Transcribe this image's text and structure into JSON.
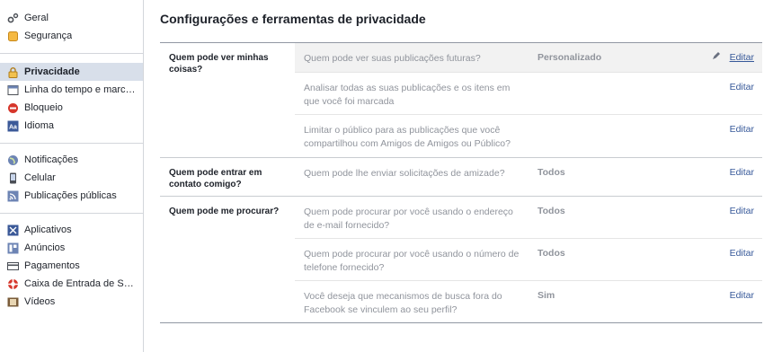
{
  "sidebar": {
    "groups": [
      {
        "items": [
          {
            "label": "Geral",
            "icon": "gears-icon"
          },
          {
            "label": "Segurança",
            "icon": "badge-icon"
          }
        ]
      },
      {
        "items": [
          {
            "label": "Privacidade",
            "icon": "lock-icon",
            "active": true
          },
          {
            "label": "Linha do tempo e marca...",
            "icon": "timeline-icon"
          },
          {
            "label": "Bloqueio",
            "icon": "block-icon"
          },
          {
            "label": "Idioma",
            "icon": "language-icon"
          }
        ]
      },
      {
        "items": [
          {
            "label": "Notificações",
            "icon": "globe-icon"
          },
          {
            "label": "Celular",
            "icon": "phone-icon"
          },
          {
            "label": "Publicações públicas",
            "icon": "rss-icon"
          }
        ]
      },
      {
        "items": [
          {
            "label": "Aplicativos",
            "icon": "apps-icon"
          },
          {
            "label": "Anúncios",
            "icon": "ads-icon"
          },
          {
            "label": "Pagamentos",
            "icon": "card-icon"
          },
          {
            "label": "Caixa de Entrada de Su...",
            "icon": "lifebuoy-icon"
          },
          {
            "label": "Vídeos",
            "icon": "film-icon"
          }
        ]
      }
    ]
  },
  "main": {
    "title": "Configurações e ferramentas de privacidade",
    "edit_label": "Editar",
    "sections": [
      {
        "label": "Quem pode ver minhas coisas?",
        "rows": [
          {
            "question": "Quem pode ver suas publicações futuras?",
            "value": "Personalizado"
          },
          {
            "question": "Analisar todas as suas publicações e os itens em que você foi marcada",
            "value": ""
          },
          {
            "question": "Limitar o público para as publicações que você compartilhou com Amigos de Amigos ou Público?",
            "value": ""
          }
        ]
      },
      {
        "label": "Quem pode entrar em contato comigo?",
        "rows": [
          {
            "question": "Quem pode lhe enviar solicitações de amizade?",
            "value": "Todos"
          }
        ]
      },
      {
        "label": "Quem pode me procurar?",
        "rows": [
          {
            "question": "Quem pode procurar por você usando o endereço de e-mail fornecido?",
            "value": "Todos"
          },
          {
            "question": "Quem pode procurar por você usando o número de telefone fornecido?",
            "value": "Todos"
          },
          {
            "question": "Você deseja que mecanismos de busca fora do Facebook se vinculem ao seu perfil?",
            "value": "Sim"
          }
        ]
      }
    ]
  }
}
